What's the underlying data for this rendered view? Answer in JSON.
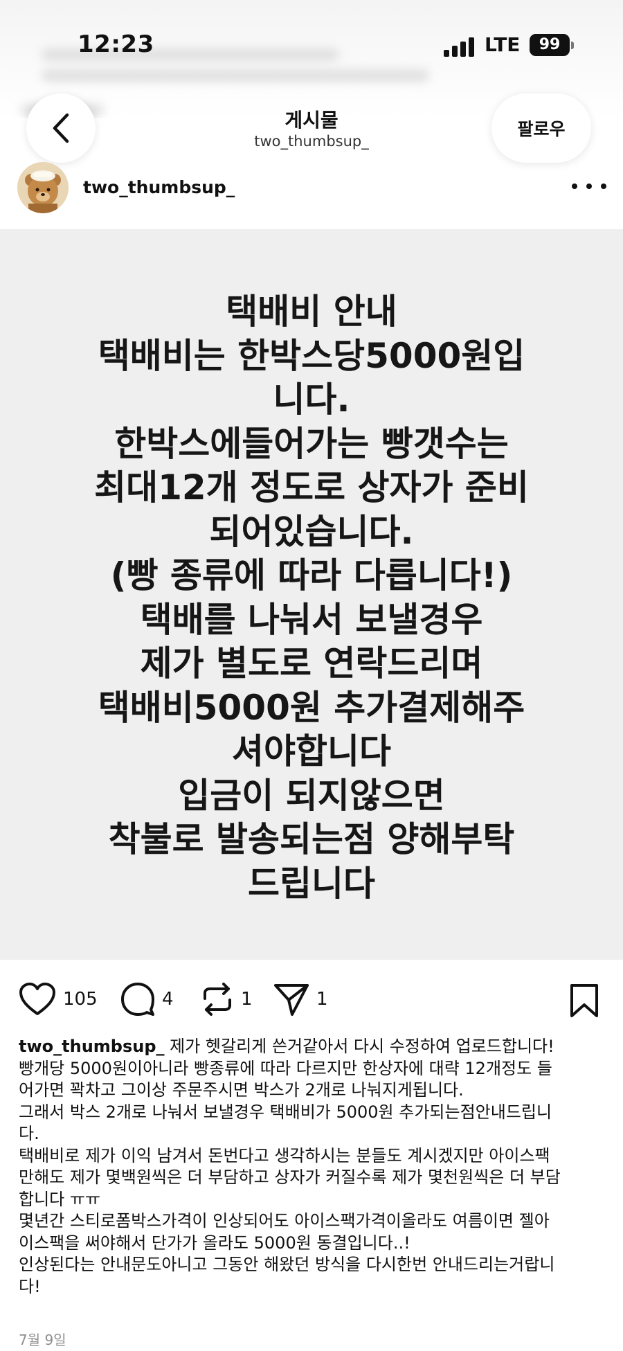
{
  "status_bar": {
    "time": "12:23",
    "network": "LTE",
    "battery": "99"
  },
  "nav": {
    "title": "게시물",
    "subtitle": "two_thumbsup_",
    "follow_label": "팔로우"
  },
  "post": {
    "username": "two_thumbsup_",
    "image_text": "택배비 안내\n택배비는 한박스당5000원입\n니다.\n한박스에들어가는 빵갯수는\n최대12개 정도로 상자가 준비\n되어있습니다.\n(빵 종류에 따라 다릅니다!)\n택배를 나눠서 보낼경우\n제가 별도로 연락드리며\n택배비5000원 추가결제해주\n셔야합니다\n입금이 되지않으면\n착불로 발송되는점 양해부탁\n드립니다",
    "likes": "105",
    "comments": "4",
    "reposts": "1",
    "shares": "1",
    "caption_first": " 제가 헷갈리게 쓴거같아서 다시 수정하여 업로드합니다!",
    "caption_lines": [
      "빵개당 5000원이아니라 빵종류에 따라 다르지만 한상자에 대략 12개정도 들",
      "어가면 꽉차고 그이상 주문주시면 박스가 2개로 나눠지게됩니다.",
      "그래서 박스 2개로 나눠서 보낼경우 택배비가 5000원 추가되는점안내드립니",
      "다.",
      "택배비로 제가 이익 남겨서  돈번다고 생각하시는 분들도 계시겠지만 아이스팩",
      "만해도 제가 몇백원씩은 더 부담하고 상자가 커질수록 제가 몇천원씩은 더 부담",
      "합니다 ㅠㅠ",
      "몇년간 스티로폼박스가격이 인상되어도 아이스팩가격이올라도 여름이면 젤아",
      "이스팩을 써야해서 단가가 올라도 5000원 동결입니다..!",
      "인상된다는 안내문도아니고 그동안 해왔던 방식을 다시한번 안내드리는거랍니",
      "다!"
    ],
    "date": "7월 9일"
  }
}
